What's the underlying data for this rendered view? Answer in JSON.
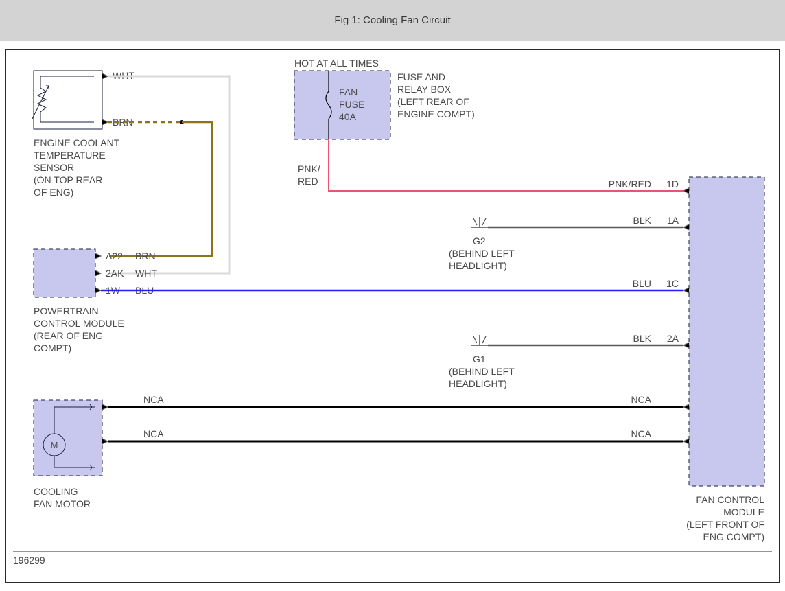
{
  "title": "Fig 1: Cooling Fan Circuit",
  "doc_id": "196299",
  "components": {
    "ect_sensor": {
      "label_l1": "ENGINE COOLANT",
      "label_l2": "TEMPERATURE",
      "label_l3": "SENSOR",
      "label_l4": "(ON TOP REAR",
      "label_l5": "OF ENG)",
      "pin_wht": "WHT",
      "pin_brn": "BRN"
    },
    "pcm": {
      "label_l1": "POWERTRAIN",
      "label_l2": "CONTROL MODULE",
      "label_l3": "(REAR OF ENG",
      "label_l4": "COMPT)",
      "pin_a22": "A22",
      "pin_a22_color": "BRN",
      "pin_2ak": "2AK",
      "pin_2ak_color": "WHT",
      "pin_1w": "1W",
      "pin_1w_color": "BLU"
    },
    "fan_motor": {
      "label_l1": "COOLING",
      "label_l2": "FAN MOTOR",
      "glyph": "M",
      "pin_top_color": "NCA",
      "pin_bot_color": "NCA"
    },
    "fuse_box": {
      "header": "HOT AT ALL TIMES",
      "label_l1": "FUSE AND",
      "label_l2": "RELAY BOX",
      "label_l3": "(LEFT REAR OF",
      "label_l4": "ENGINE COMPT)",
      "fuse_l1": "FAN",
      "fuse_l2": "FUSE",
      "fuse_l3": "40A",
      "out_color_l1": "PNK/",
      "out_color_l2": "RED"
    },
    "g2": {
      "name": "G2",
      "loc_l1": "(BEHIND LEFT",
      "loc_l2": "HEADLIGHT)"
    },
    "g1": {
      "name": "G1",
      "loc_l1": "(BEHIND LEFT",
      "loc_l2": "HEADLIGHT)"
    },
    "fan_ctrl": {
      "label_l1": "FAN CONTROL",
      "label_l2": "MODULE",
      "label_l3": "(LEFT FRONT OF",
      "label_l4": "ENG COMPT)",
      "pin_1d": "1D",
      "pin_1d_color": "PNK/RED",
      "pin_1a": "1A",
      "pin_1a_color": "BLK",
      "pin_1c": "1C",
      "pin_1c_color": "BLU",
      "pin_2a": "2A",
      "pin_2a_color": "BLK",
      "pin_nca_top": "NCA",
      "pin_nca_bot": "NCA"
    }
  }
}
